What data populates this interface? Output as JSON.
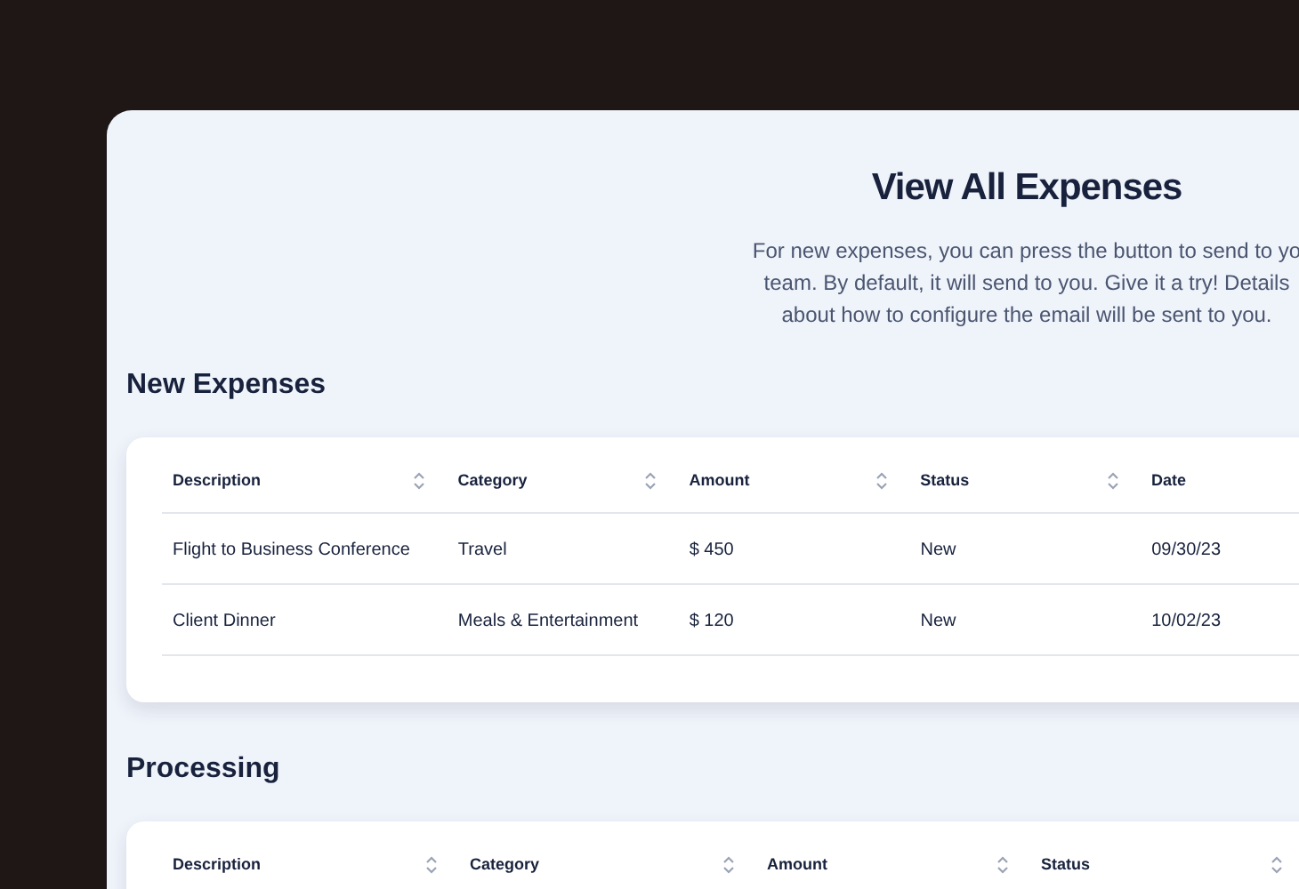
{
  "title": "View All Expenses",
  "description_lines": [
    "For new expenses, you can press the button to send to yo",
    "team. By default, it will send to you. Give it a try! Details",
    "about how to configure the email will be sent to you."
  ],
  "sections": [
    {
      "heading": "New Expenses",
      "columns": [
        "Description",
        "Category",
        "Amount",
        "Status",
        "Date"
      ],
      "rows": [
        [
          "Flight to Business Conference",
          "Travel",
          "$ 450",
          "New",
          "09/30/23"
        ],
        [
          "Client Dinner",
          "Meals & Entertainment",
          "$ 120",
          "New",
          "10/02/23"
        ]
      ]
    },
    {
      "heading": "Processing",
      "columns": [
        "Description",
        "Category",
        "Amount",
        "Status"
      ]
    }
  ]
}
